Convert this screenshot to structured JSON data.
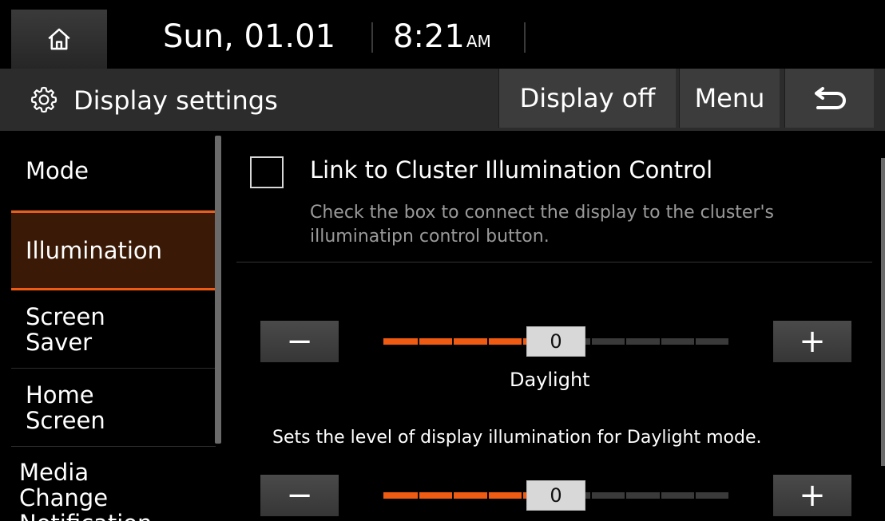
{
  "status": {
    "date": "Sun, 01.01",
    "time": "8:21",
    "ampm": "AM"
  },
  "header": {
    "title": "Display settings",
    "display_off": "Display off",
    "menu": "Menu"
  },
  "sidebar": {
    "items": [
      {
        "label": "Mode"
      },
      {
        "label": "Illumination"
      },
      {
        "label": "Screen\nSaver"
      },
      {
        "label": "Home\nScreen"
      },
      {
        "label": "Media\nChange\nNotification"
      }
    ],
    "active_index": 1
  },
  "main": {
    "link": {
      "checked": false,
      "label": "Link to Cluster Illumination Control",
      "description": "Check the box to connect the display to the cluster's illuminatipn control button."
    },
    "sliders": [
      {
        "value": "0",
        "level": 0.5,
        "label": "Daylight",
        "description": "Sets the level of display illumination for Daylight mode."
      },
      {
        "value": "0",
        "level": 0.5
      }
    ],
    "minus_symbol": "−",
    "plus_symbol": "+"
  },
  "colors": {
    "accent": "#f05b13",
    "active_bg": "#3a1a06",
    "titlebar": "#2c2c2c",
    "button": "#3c3c3c"
  }
}
